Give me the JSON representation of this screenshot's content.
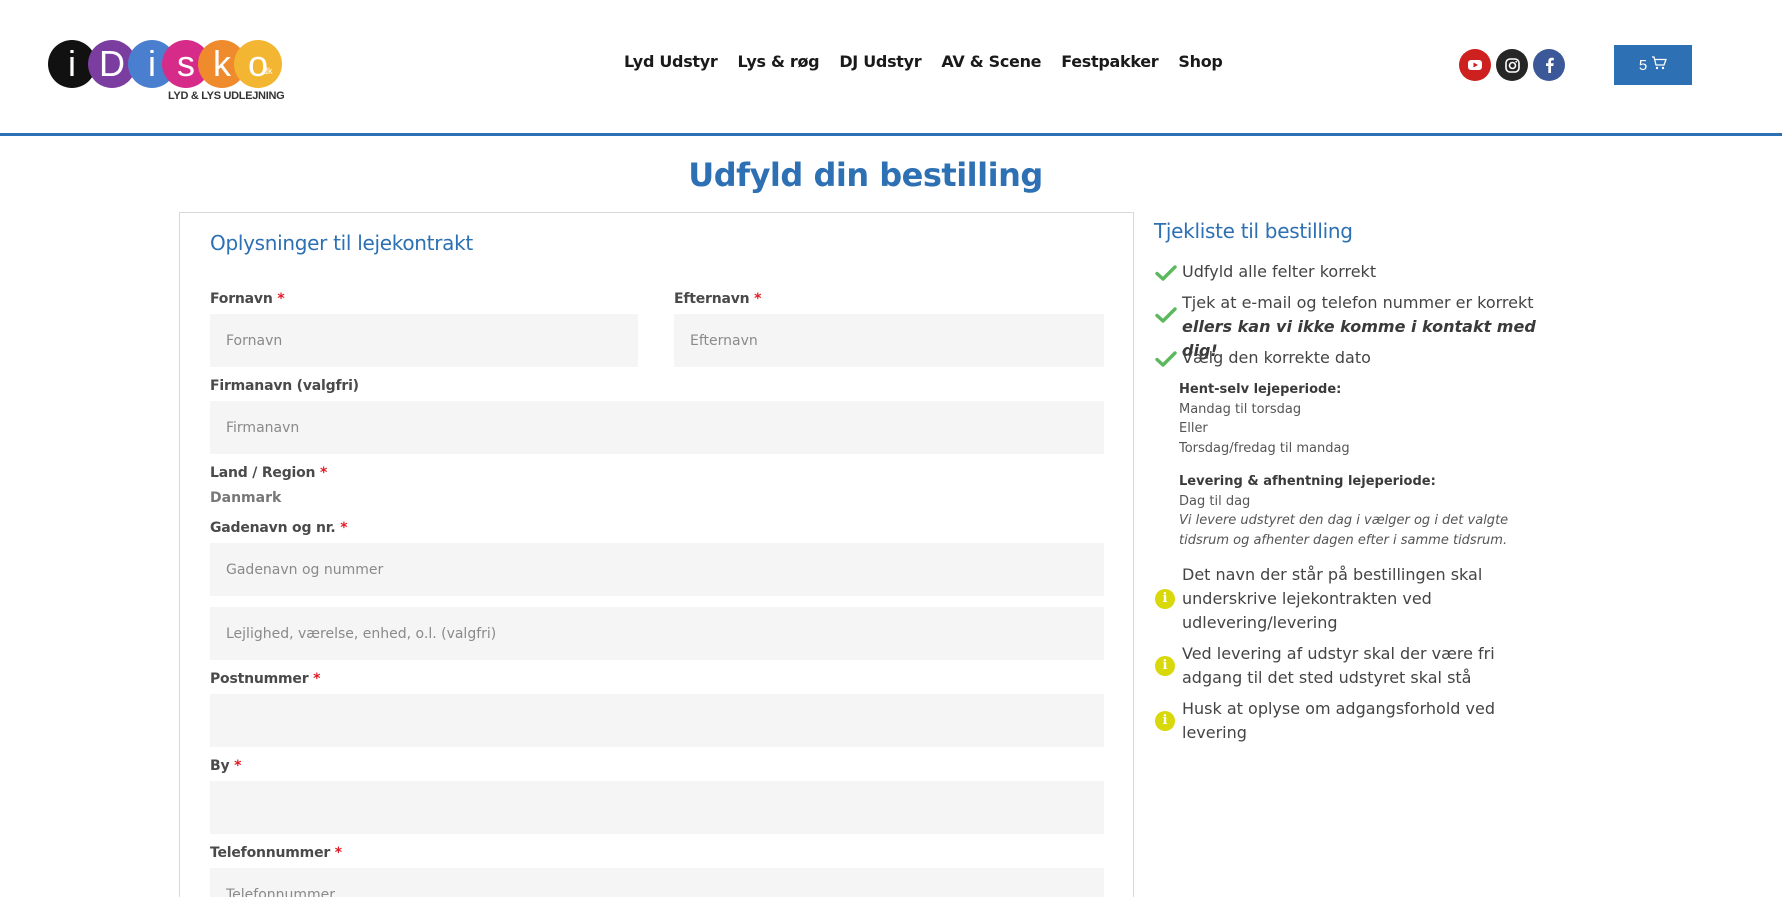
{
  "header": {
    "logo": {
      "letters": [
        "i",
        "D",
        "i",
        "s",
        "k",
        "o"
      ],
      "colors": [
        "#111111",
        "#7b3ea0",
        "#4a7fcf",
        "#d72b8a",
        "#ef8a2d",
        "#f2b632"
      ],
      "suffix": "dk",
      "tagline": "LYD & LYS UDLEJNING"
    },
    "nav": [
      "Lyd Udstyr",
      "Lys & røg",
      "DJ Udstyr",
      "AV & Scene",
      "Festpakker",
      "Shop"
    ],
    "social": [
      "youtube-icon",
      "instagram-icon",
      "facebook-icon"
    ],
    "cart": {
      "count": "5",
      "icon": "cart-icon"
    },
    "accent_color": "#2d70b3"
  },
  "page": {
    "title": "Udfyld din bestilling"
  },
  "form": {
    "title": "Oplysninger til lejekontrakt",
    "required_mark": "*",
    "first_name": {
      "label": "Fornavn",
      "placeholder": "Fornavn",
      "value": ""
    },
    "last_name": {
      "label": "Efternavn",
      "placeholder": "Efternavn",
      "value": ""
    },
    "company": {
      "label": "Firmanavn (valgfri)",
      "placeholder": "Firmanavn",
      "value": ""
    },
    "country": {
      "label": "Land / Region",
      "value": "Danmark"
    },
    "street": {
      "label": "Gadenavn og nr.",
      "placeholder": "Gadenavn og nummer",
      "value": ""
    },
    "apartment": {
      "placeholder": "Lejlighed, værelse, enhed, o.l. (valgfri)",
      "value": ""
    },
    "postcode": {
      "label": "Postnummer",
      "value": ""
    },
    "city": {
      "label": "By",
      "value": ""
    },
    "phone": {
      "label": "Telefonnummer",
      "placeholder": "Telefonnummer",
      "value": ""
    }
  },
  "checklist": {
    "title": "Tjekliste til bestilling",
    "items": [
      {
        "icon": "check-icon",
        "text": "Udfyld alle felter korrekt"
      },
      {
        "icon": "check-icon",
        "text": "Tjek at e-mail og telefon nummer er korrekt",
        "emphasis": "ellers kan vi ikke komme i kontakt med dig!"
      },
      {
        "icon": "check-icon",
        "text": "Vælg den korrekte dato"
      }
    ],
    "pickup": {
      "heading": "Hent-selv lejeperiode:",
      "lines": [
        "Mandag til torsdag",
        "Eller",
        "Torsdag/fredag til mandag"
      ]
    },
    "delivery": {
      "heading": "Levering & afhentning lejeperiode:",
      "line": "Dag til dag",
      "note": "Vi levere udstyret den dag i vælger og i det valgte tidsrum og afhenter dagen efter i samme tidsrum."
    },
    "info_items": [
      {
        "icon": "info-icon",
        "text": "Det navn der står på bestillingen skal underskrive lejekontrakten ved udlevering/levering"
      },
      {
        "icon": "info-icon",
        "text": "Ved levering af udstyr skal der være fri adgang til det sted udstyret skal stå"
      },
      {
        "icon": "info-icon",
        "text": "Husk at oplyse om adgangsforhold ved levering"
      }
    ],
    "check_color": "#5cb85c",
    "info_color": "#d8d80a"
  }
}
